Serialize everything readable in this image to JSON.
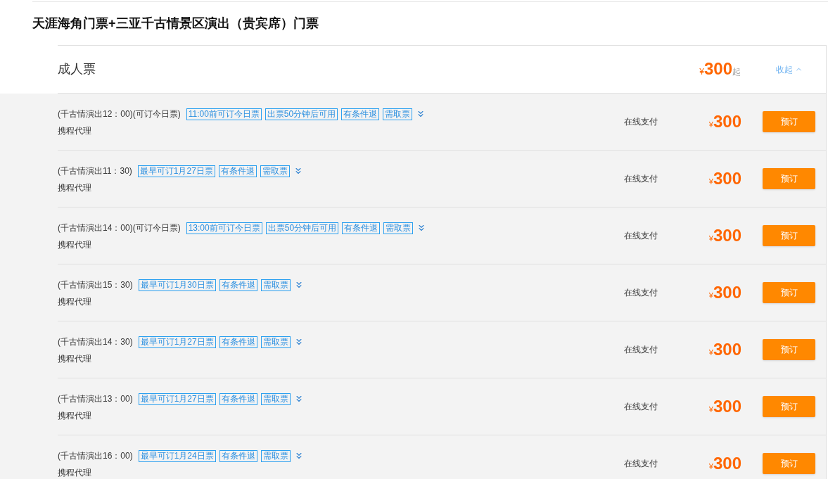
{
  "title": "天涯海角门票+三亚千古情景区演出（贵宾席）门票",
  "section": {
    "name": "成人票",
    "currency": "¥",
    "price": "300",
    "price_suffix": "起",
    "toggle_label": "收起",
    "expanded": true
  },
  "rows": [
    {
      "name": "(千古情演出12：00)(可订今日票)",
      "tags": [
        "11:00前可订今日票",
        "出票50分钟后可用",
        "有条件退",
        "需取票"
      ],
      "supplier": "携程代理",
      "payment": "在线支付",
      "currency": "¥",
      "price": "300",
      "button": "预订"
    },
    {
      "name": "(千古情演出11：30)",
      "tags": [
        "最早可订1月27日票",
        "有条件退",
        "需取票"
      ],
      "supplier": "携程代理",
      "payment": "在线支付",
      "currency": "¥",
      "price": "300",
      "button": "预订"
    },
    {
      "name": "(千古情演出14：00)(可订今日票)",
      "tags": [
        "13:00前可订今日票",
        "出票50分钟后可用",
        "有条件退",
        "需取票"
      ],
      "supplier": "携程代理",
      "payment": "在线支付",
      "currency": "¥",
      "price": "300",
      "button": "预订"
    },
    {
      "name": "(千古情演出15：30)",
      "tags": [
        "最早可订1月30日票",
        "有条件退",
        "需取票"
      ],
      "supplier": "携程代理",
      "payment": "在线支付",
      "currency": "¥",
      "price": "300",
      "button": "预订"
    },
    {
      "name": "(千古情演出14：30)",
      "tags": [
        "最早可订1月27日票",
        "有条件退",
        "需取票"
      ],
      "supplier": "携程代理",
      "payment": "在线支付",
      "currency": "¥",
      "price": "300",
      "button": "预订"
    },
    {
      "name": "(千古情演出13：00)",
      "tags": [
        "最早可订1月27日票",
        "有条件退",
        "需取票"
      ],
      "supplier": "携程代理",
      "payment": "在线支付",
      "currency": "¥",
      "price": "300",
      "button": "预订"
    },
    {
      "name": "(千古情演出16：00)",
      "tags": [
        "最早可订1月24日票",
        "有条件退",
        "需取票"
      ],
      "supplier": "携程代理",
      "payment": "在线支付",
      "currency": "¥",
      "price": "300",
      "button": "预订"
    }
  ]
}
